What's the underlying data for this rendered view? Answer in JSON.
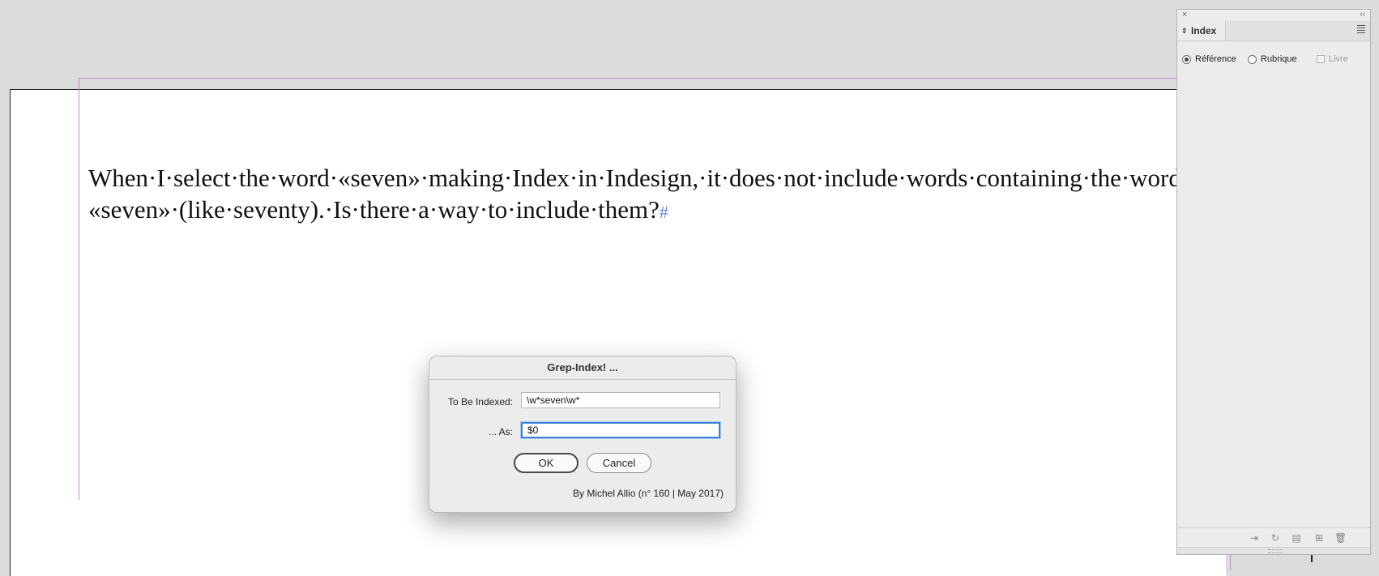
{
  "document": {
    "line1": "When·I·select·the·word·«seven»·making·Index·in·Indesign,·it·does·not·include·words·containing·the·word",
    "line2": "«seven»·(like·seventy).·Is·there·a·way·to·include·them?",
    "end_mark": "#"
  },
  "dialog": {
    "title": "Grep-Index! ...",
    "field1_label": "To Be Indexed:",
    "field1_value": "\\w*seven\\w*",
    "field2_label": "... As:",
    "field2_value": "$0",
    "ok_label": "OK",
    "cancel_label": "Cancel",
    "credit": "By Michel Allio (n° 160 | May 2017)"
  },
  "panel": {
    "close_icon": "×",
    "collapse_icon": "‹‹",
    "tab_label": "Index",
    "option_reference": "Référence",
    "option_topic": "Rubrique",
    "option_book": "Livre",
    "selected_option": "Référence",
    "footer_icons": [
      "goto-icon",
      "update-icon",
      "generate-index-icon",
      "new-entry-icon",
      "trash-icon"
    ]
  },
  "colors": {
    "frame": "#c08ad2",
    "accent": "#3b84d8",
    "hidden_char": "#5a8fe0"
  }
}
